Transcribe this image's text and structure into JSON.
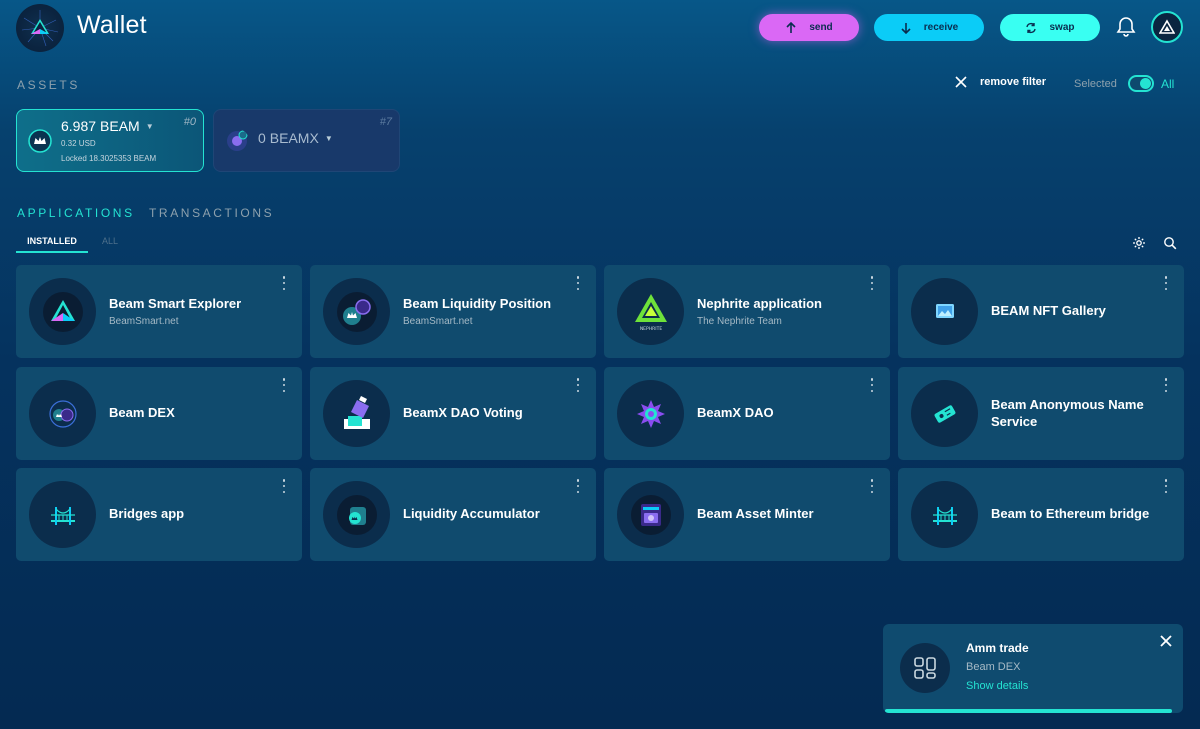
{
  "header": {
    "title": "Wallet",
    "send_label": "send",
    "receive_label": "receive",
    "swap_label": "swap"
  },
  "assets": {
    "section_label": "ASSETS",
    "remove_filter_label": "remove filter",
    "selected_label": "Selected",
    "all_label": "All",
    "items": [
      {
        "amount": "6.987",
        "symbol": "BEAM",
        "usd": "0.32 USD",
        "locked": "Locked  18.3025353  BEAM",
        "id": "#0"
      },
      {
        "amount": "0",
        "symbol": "BEAMX",
        "id": "#7"
      }
    ]
  },
  "tabs": {
    "applications": "APPLICATIONS",
    "transactions": "TRANSACTIONS",
    "installed": "INSTALLED",
    "all": "ALL"
  },
  "apps": [
    {
      "title": "Beam Smart Explorer",
      "subtitle": "BeamSmart.net",
      "icon": "beam-triangle-icon"
    },
    {
      "title": "Beam Liquidity Position",
      "subtitle": "BeamSmart.net",
      "icon": "liquidity-icon"
    },
    {
      "title": "Nephrite application",
      "subtitle": "The Nephrite Team",
      "icon": "nephrite-icon"
    },
    {
      "title": "BEAM NFT Gallery",
      "subtitle": "",
      "icon": "gallery-icon"
    },
    {
      "title": "Beam DEX",
      "subtitle": "",
      "icon": "dex-icon"
    },
    {
      "title": "BeamX DAO Voting",
      "subtitle": "",
      "icon": "voting-icon"
    },
    {
      "title": "BeamX DAO",
      "subtitle": "",
      "icon": "dao-icon"
    },
    {
      "title": "Beam Anonymous Name Service",
      "subtitle": "",
      "icon": "ticket-icon"
    },
    {
      "title": "Bridges app",
      "subtitle": "",
      "icon": "bridge-icon"
    },
    {
      "title": "Liquidity Accumulator",
      "subtitle": "",
      "icon": "accumulator-icon"
    },
    {
      "title": "Beam Asset Minter",
      "subtitle": "",
      "icon": "minter-icon"
    },
    {
      "title": "Beam to Ethereum bridge",
      "subtitle": "",
      "icon": "bridge-icon"
    }
  ],
  "toast": {
    "title": "Amm trade",
    "subtitle": "Beam DEX",
    "link": "Show details",
    "progress": 0.97
  },
  "colors": {
    "accent": "#24e3d2",
    "send": "#da68f5",
    "receive": "#0bccf7",
    "swap": "#39fff2",
    "card": "#104b6e"
  }
}
